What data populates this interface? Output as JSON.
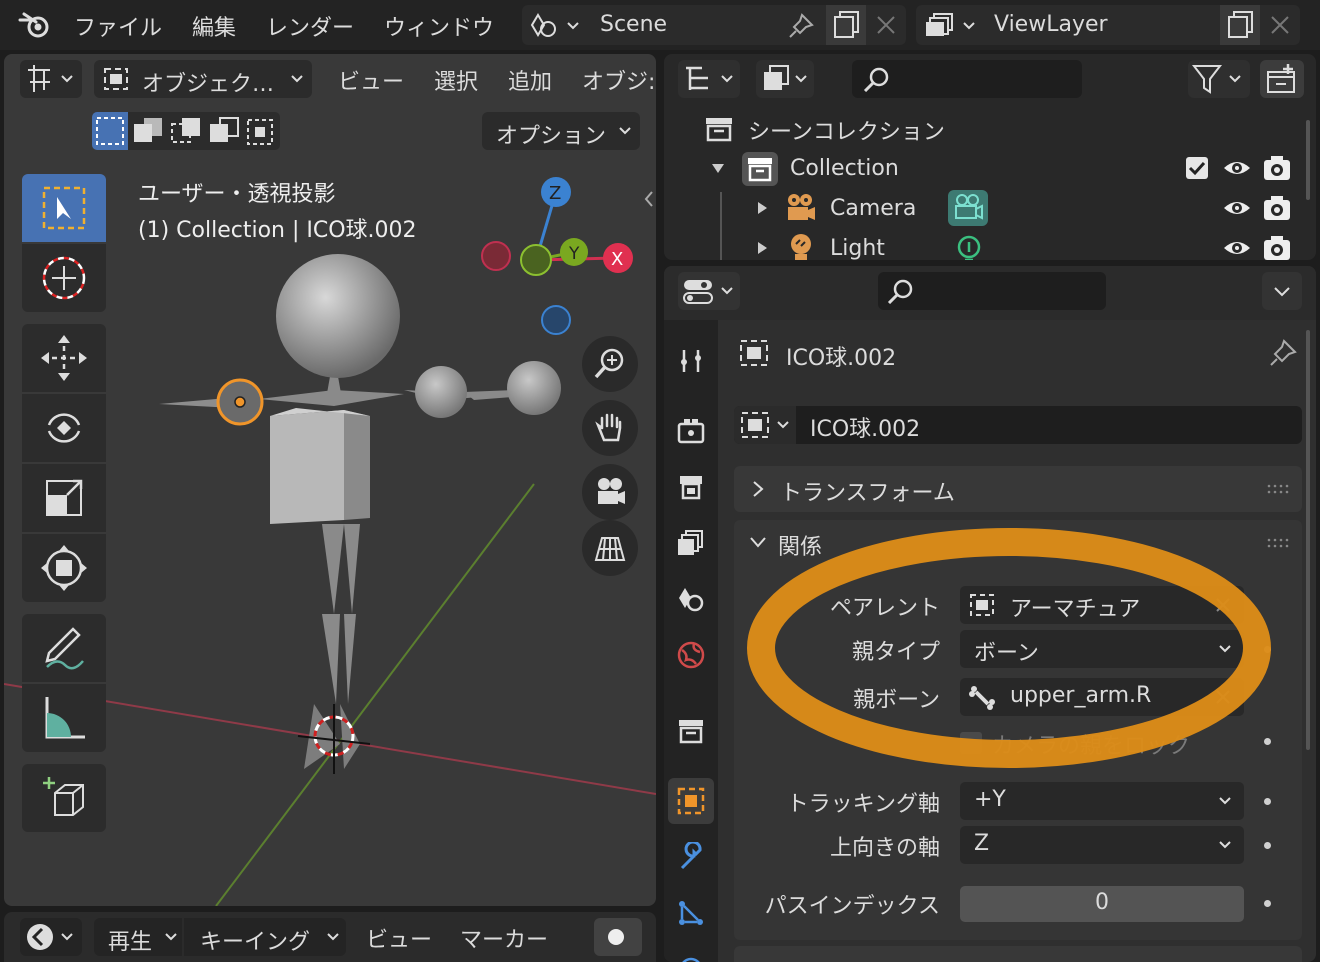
{
  "topbar": {
    "menus": [
      "ファイル",
      "編集",
      "レンダー",
      "ウィンドウ"
    ],
    "scene_name": "Scene",
    "view_layer_name": "ViewLayer"
  },
  "viewport": {
    "mode_label": "オブジェク…",
    "menus": [
      "ビュー",
      "選択",
      "追加",
      "オブジ:"
    ],
    "options_label": "オプション",
    "view_title": "ユーザー・透視投影",
    "view_subtitle": "(1) Collection | ICO球.002",
    "gizmo": {
      "x": "X",
      "y": "Y",
      "z": "Z"
    }
  },
  "timeline": {
    "play_label": "再生",
    "keying_label": "キーイング",
    "view_label": "ビュー",
    "marker_label": "マーカー"
  },
  "outliner": {
    "scene_collection": "シーンコレクション",
    "collection": "Collection",
    "items": [
      {
        "name": "Camera",
        "icon": "camera-icon"
      },
      {
        "name": "Light",
        "icon": "light-icon"
      }
    ]
  },
  "properties": {
    "object_name": "ICO球.002",
    "datablock_name": "ICO球.002",
    "panels": {
      "transform": "トランスフォーム",
      "relations": "関係"
    },
    "relations": {
      "parent_label": "ペアレント",
      "parent_value": "アーマチュア",
      "parent_type_label": "親タイプ",
      "parent_type_value": "ボーン",
      "parent_bone_label": "親ボーン",
      "parent_bone_value": "upper_arm.R",
      "lock_camera_label": "カメラの親をロック",
      "tracking_axis_label": "トラッキング軸",
      "tracking_axis_value": "+Y",
      "up_axis_label": "上向きの軸",
      "up_axis_value": "Z",
      "pass_index_label": "パスインデックス",
      "pass_index_value": "0"
    }
  },
  "colors": {
    "highlight_ellipse": "#e0901a",
    "accent_blue": "#4772b3",
    "object_orange": "#f0952a"
  }
}
